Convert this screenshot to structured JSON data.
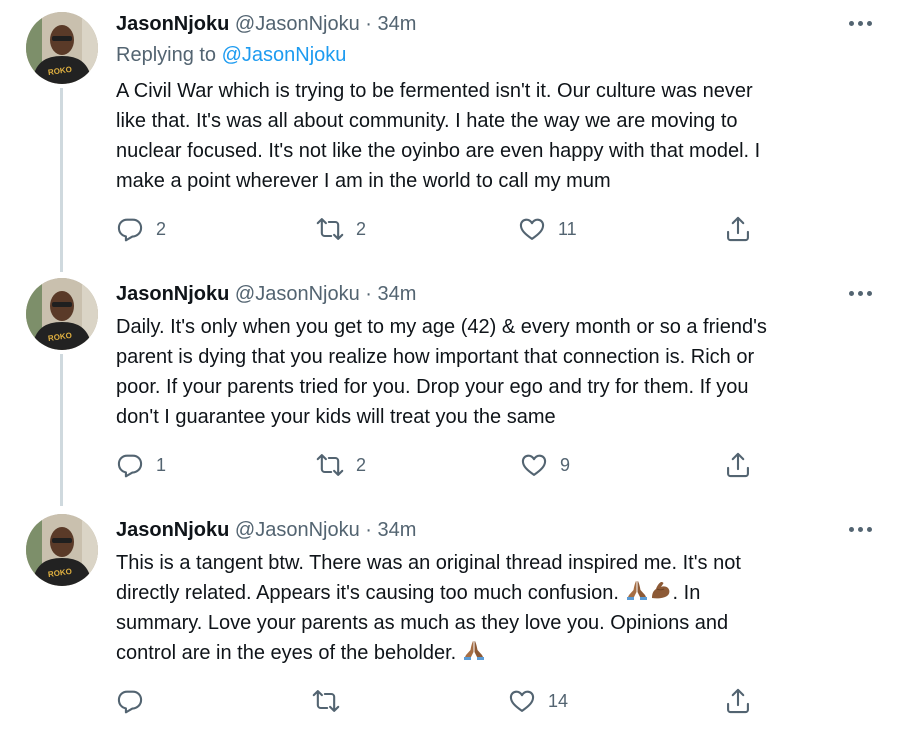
{
  "colors": {
    "text": "#0f1419",
    "muted": "#536471",
    "link": "#1d9bf0",
    "line": "#cfd9de"
  },
  "tweets": [
    {
      "name": "JasonNjoku",
      "handle": "@JasonNjoku",
      "separator": "·",
      "time": "34m",
      "replying_label": "Replying to ",
      "replying_to": "@JasonNjoku",
      "text": "A Civil War which is trying to be fermented isn't it. Our culture was never\nlike that. It's was all about community. I hate the way we are moving to\nnuclear focused. It's not like the oyinbo are even happy with that model. I\nmake a point wherever I am in the world to call my mum",
      "replies": "2",
      "retweets": "2",
      "likes": "11"
    },
    {
      "name": "JasonNjoku",
      "handle": "@JasonNjoku",
      "separator": "·",
      "time": "34m",
      "text": "Daily. It's only when you get to my age (42) & every month or so a friend's\nparent is dying that you realize how important that connection is. Rich or\npoor. If your parents tried for you. Drop your ego and try for them. If you\ndon't I guarantee your kids will treat you the same",
      "replies": "1",
      "retweets": "2",
      "likes": "9"
    },
    {
      "name": "JasonNjoku",
      "handle": "@JasonNjoku",
      "separator": "·",
      "time": "34m",
      "text_line1": "This is a tangent btw. There was an original thread inspired me. It's not",
      "text_line2a": "directly related. Appears it's causing too much confusion. ",
      "text_line2b": ". In",
      "text_line3": "summary. Love your parents as much as they love you. Opinions and",
      "text_line4": "control are in the eyes of the beholder. ",
      "replies": "",
      "retweets": "",
      "likes": "14"
    }
  ],
  "icons": {
    "reply": "reply-icon",
    "retweet": "retweet-icon",
    "like": "like-icon",
    "share": "share-icon",
    "more": "more-icon",
    "pray": "folded-hands-emoji",
    "flex": "flexed-biceps-emoji"
  }
}
